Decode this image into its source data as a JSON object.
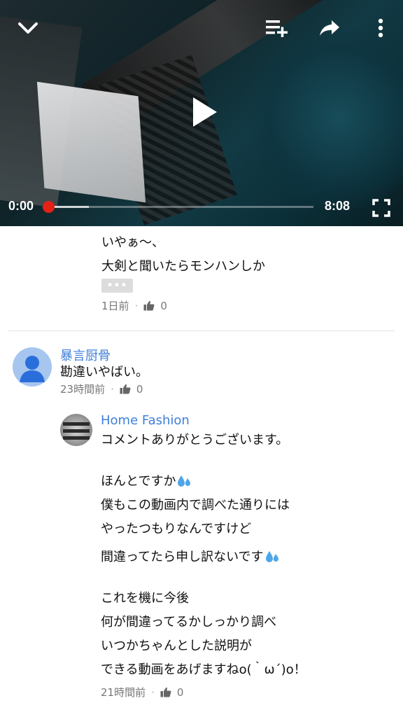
{
  "player": {
    "current_time": "0:00",
    "duration": "8:08",
    "progress_fraction": 0.0,
    "buffered_fraction": 0.15,
    "icons": {
      "collapse": "chevron-down-icon",
      "add_to_queue": "playlist-add-icon",
      "share": "share-icon",
      "more": "more-vertical-icon",
      "play": "play-icon",
      "fullscreen": "fullscreen-icon"
    }
  },
  "comments": [
    {
      "lines": [
        "いやぁ〜、",
        "大剣と聞いたらモンハンしか"
      ],
      "more_label": "•••",
      "time": "1日前",
      "likes": "0"
    },
    {
      "author": "暴言厨骨",
      "text": "勘違いやばい。",
      "time": "23時間前",
      "likes": "0"
    },
    {
      "author": "Home Fashion",
      "lines": [
        "コメントありがとうございます。",
        "",
        "ほんとですか",
        "僕もこの動画内で調べた通りには",
        "やったつもりなんですけど",
        "間違ってたら申し訳ないです",
        "",
        "これを機に今後",
        "何が間違ってるかしっかり調べ",
        "いつかちゃんとした説明が",
        "できる動画をあげますねo(｀ω´)o！"
      ],
      "time": "21時間前",
      "likes": "0"
    }
  ],
  "colors": {
    "progress": "#e62117",
    "author_link": "#3f7fd9",
    "meta_text": "#777777",
    "sweat_emoji": "#4ea6e8"
  }
}
